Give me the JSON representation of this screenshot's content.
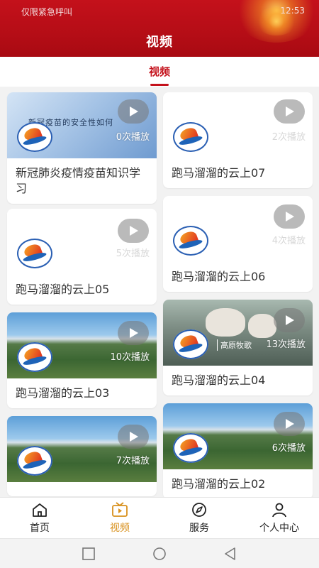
{
  "status_bar": {
    "left_text": "仅限紧急呼叫",
    "time": "12:53"
  },
  "header": {
    "title": "视频"
  },
  "tabs": [
    {
      "label": "视频"
    }
  ],
  "videos": [
    {
      "title": "新冠肺炎疫情疫苗知识学习",
      "plays": "0次播放",
      "thumb": "tech",
      "caption": "新冠疫苗的安全性如何"
    },
    {
      "title": "跑马溜溜的云上07",
      "plays": "2次播放",
      "thumb": "blank"
    },
    {
      "title": "跑马溜溜的云上05",
      "plays": "5次播放",
      "thumb": "blank"
    },
    {
      "title": "跑马溜溜的云上06",
      "plays": "4次播放",
      "thumb": "blank"
    },
    {
      "title": "跑马溜溜的云上03",
      "plays": "10次播放",
      "thumb": "landscape"
    },
    {
      "title": "跑马溜溜的云上04",
      "plays": "13次播放",
      "thumb": "animals",
      "caption": "高原牧歌"
    },
    {
      "title": "",
      "plays": "7次播放",
      "thumb": "landscape"
    },
    {
      "title": "跑马溜溜的云上02",
      "plays": "6次播放",
      "thumb": "landscape"
    }
  ],
  "bottom_nav": [
    {
      "label": "首页",
      "icon": "home-icon"
    },
    {
      "label": "视频",
      "icon": "video-icon",
      "active": true
    },
    {
      "label": "服务",
      "icon": "compass-icon"
    },
    {
      "label": "个人中心",
      "icon": "user-icon"
    }
  ],
  "colors": {
    "primary": "#c4111b",
    "nav_active": "#d8901c"
  }
}
